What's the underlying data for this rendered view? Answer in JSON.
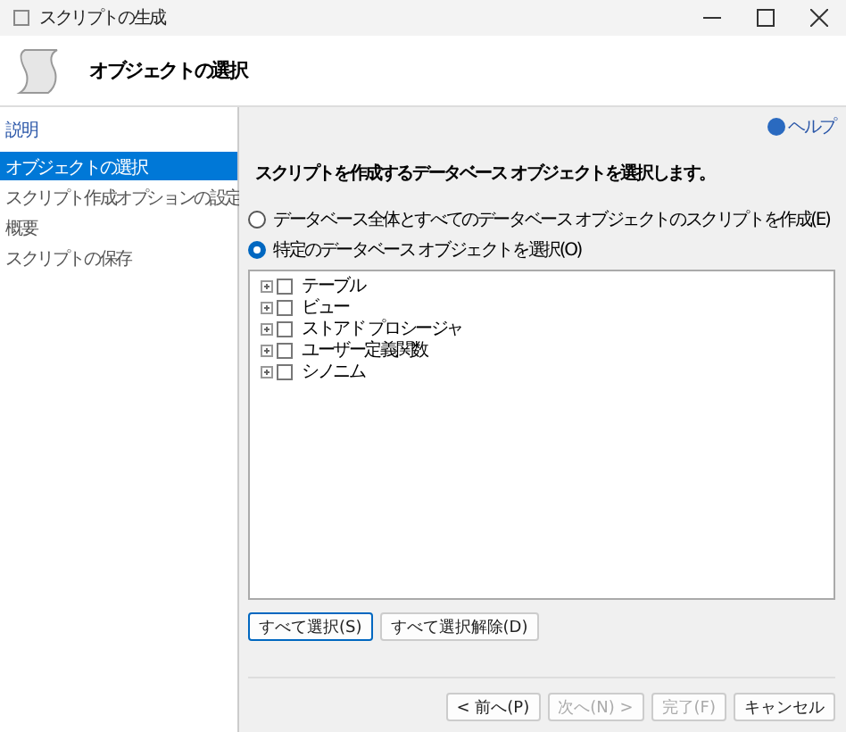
{
  "window": {
    "title": "スクリプトの生成"
  },
  "header": {
    "title": "オブジェクトの選択"
  },
  "sidebar": {
    "heading": "説明",
    "items": [
      {
        "label": "オブジェクトの選択",
        "selected": true
      },
      {
        "label": "スクリプト作成オプションの設定",
        "selected": false
      },
      {
        "label": "概要",
        "selected": false
      },
      {
        "label": "スクリプトの保存",
        "selected": false
      }
    ]
  },
  "help": "ヘルプ",
  "instruction": "スクリプトを作成するデータベース オブジェクトを選択します。",
  "options": [
    {
      "label": "データベース全体とすべてのデータベース オブジェクトのスクリプトを作成(E)",
      "selected": false
    },
    {
      "label": "特定のデータベース オブジェクトを選択(O)",
      "selected": true
    }
  ],
  "tree": [
    {
      "label": "テーブル",
      "checked": false
    },
    {
      "label": "ビュー",
      "checked": false
    },
    {
      "label": "ストアド プロシージャ",
      "checked": false
    },
    {
      "label": "ユーザー定義関数",
      "checked": false
    },
    {
      "label": "シノニム",
      "checked": false
    }
  ],
  "select_buttons": [
    "すべて選択(S)",
    "すべて選択解除(D)"
  ],
  "nav_buttons": [
    {
      "label": "< 前へ(P)",
      "disabled": false
    },
    {
      "label": "次へ(N) >",
      "disabled": true
    },
    {
      "label": "完了(F)",
      "disabled": true
    },
    {
      "label": "キャンセル",
      "disabled": false
    }
  ]
}
